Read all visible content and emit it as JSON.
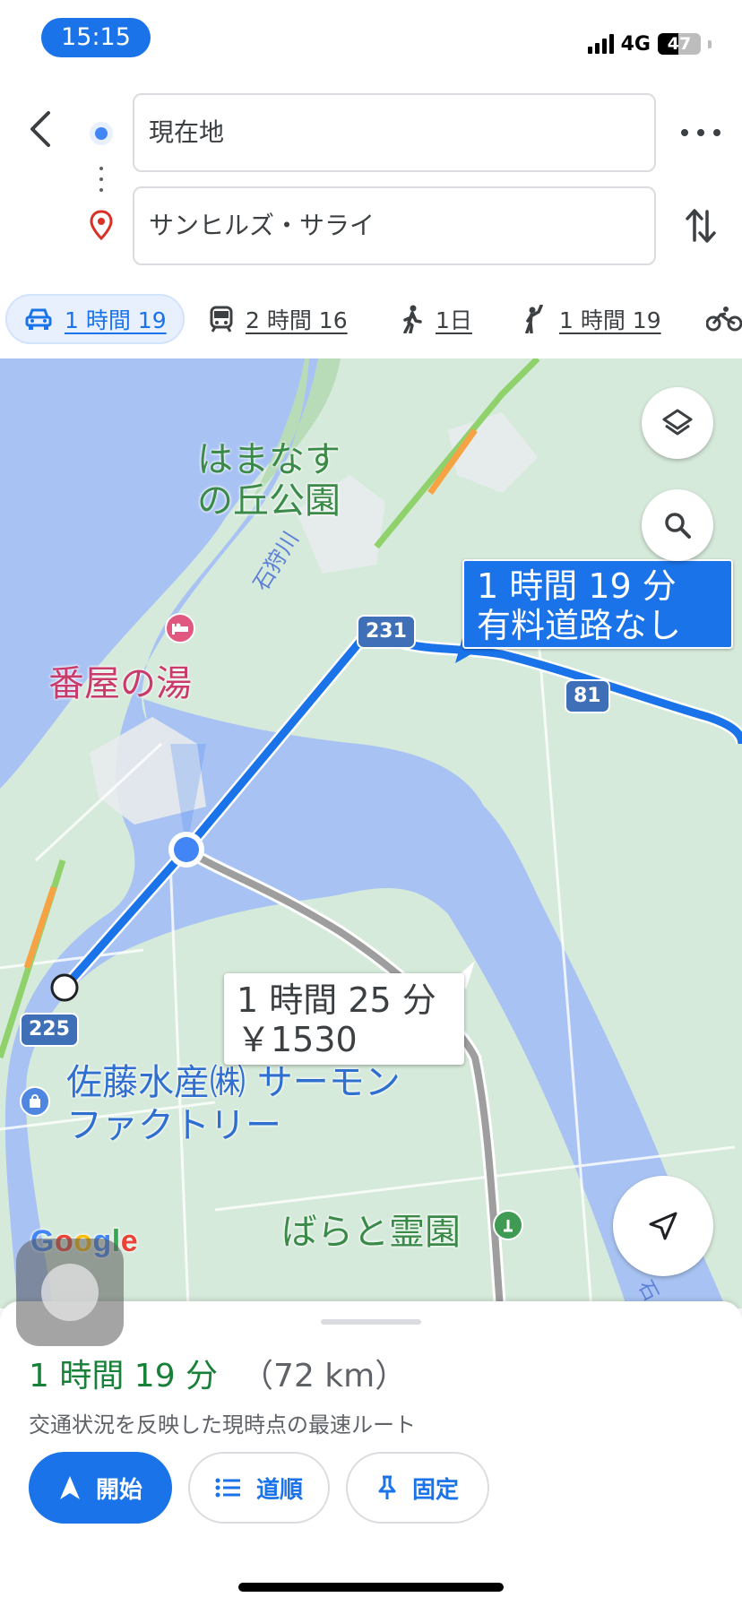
{
  "status_bar": {
    "time": "15:15",
    "network": "4G",
    "battery": "47",
    "battery_level": 0.47
  },
  "directions": {
    "origin": "現在地",
    "destination": "サンヒルズ・サライ"
  },
  "travel_modes": [
    {
      "mode": "drive",
      "label": "1 時間 19",
      "selected": true
    },
    {
      "mode": "transit",
      "label": "2 時間 16",
      "selected": false
    },
    {
      "mode": "walk",
      "label": "1日",
      "selected": false
    },
    {
      "mode": "ride-hail",
      "label": "1 時間 19",
      "selected": false
    },
    {
      "mode": "bike",
      "label": "",
      "selected": false
    }
  ],
  "map": {
    "labels": {
      "park": [
        "はまなす",
        "の丘公園"
      ],
      "river": "石狩川",
      "onsen": "番屋の湯",
      "shop": [
        "佐藤水産㈱ サーモン",
        "ファクトリー"
      ],
      "cemetery": "ばらと霊園",
      "river_partial": "石"
    },
    "route_shields": [
      "231",
      "81",
      "225"
    ],
    "main_route_callout": [
      "1 時間 19 分",
      "有料道路なし"
    ],
    "alt_route_callout": [
      "1 時間 25 分",
      "￥1530"
    ],
    "attribution": "Google",
    "colors": {
      "main_route": "#1a73e8",
      "alt_route": "#9e9e9e",
      "water": "#a8c3f3",
      "land": "#d6eadb"
    }
  },
  "summary": {
    "duration": "1 時間 19 分",
    "distance": "（72 km）",
    "note": "交通状況を反映した現時点の最速ルート"
  },
  "actions": {
    "start": "開始",
    "steps": "道順",
    "pin": "固定"
  }
}
